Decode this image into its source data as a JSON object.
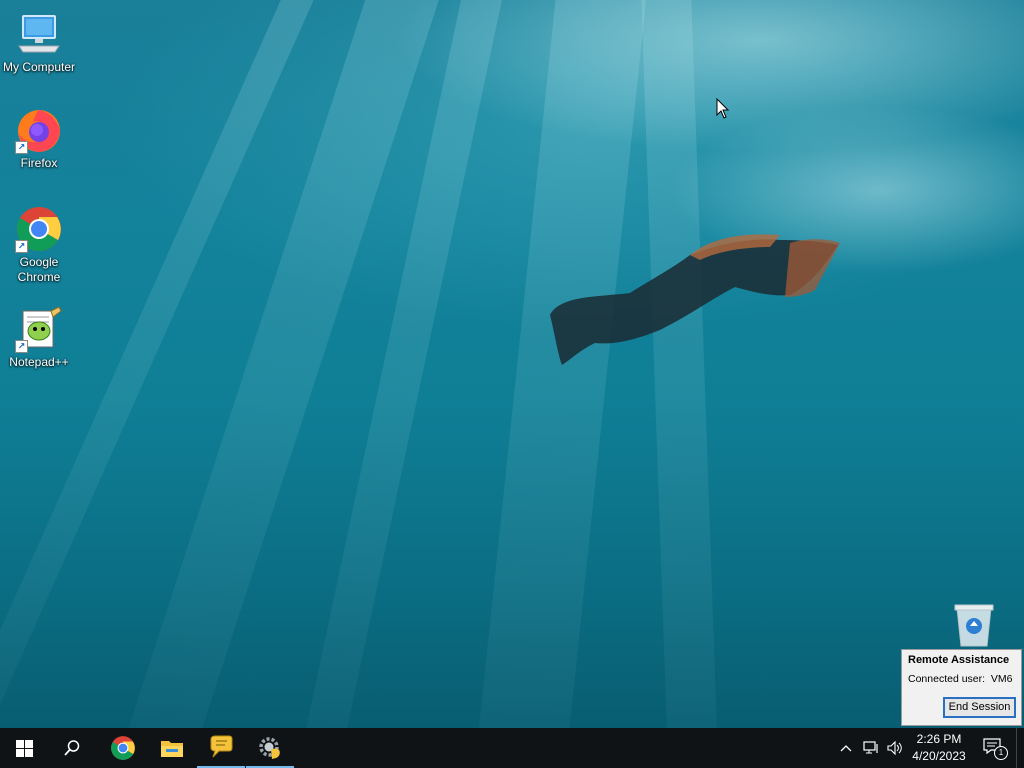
{
  "desktop_icons": [
    {
      "label": "My Computer",
      "icon": "monitor-icon"
    },
    {
      "label": "Firefox",
      "icon": "firefox-icon"
    },
    {
      "label": "Google\nChrome",
      "icon": "chrome-icon"
    },
    {
      "label": "Notepad++",
      "icon": "notepad-plus-plus-icon"
    }
  ],
  "recycle_bin": {
    "icon": "recycle-bin-icon"
  },
  "remote_assistance": {
    "title": "Remote Assistance",
    "connected_user": "Connected user:  VM6",
    "end_session_label": "End Session"
  },
  "taskbar": {
    "pinned": [
      {
        "name": "chrome-icon"
      },
      {
        "name": "file-explorer-icon"
      },
      {
        "name": "remote-assistance-chat-icon"
      },
      {
        "name": "settings-gear-icon"
      }
    ],
    "clock": {
      "time": "2:26 PM",
      "date": "4/20/2023"
    },
    "notification_count": "1"
  },
  "colors": {
    "taskbar": "#101316",
    "accent": "#2a70c2",
    "active_indicator": "#76b9ed"
  }
}
